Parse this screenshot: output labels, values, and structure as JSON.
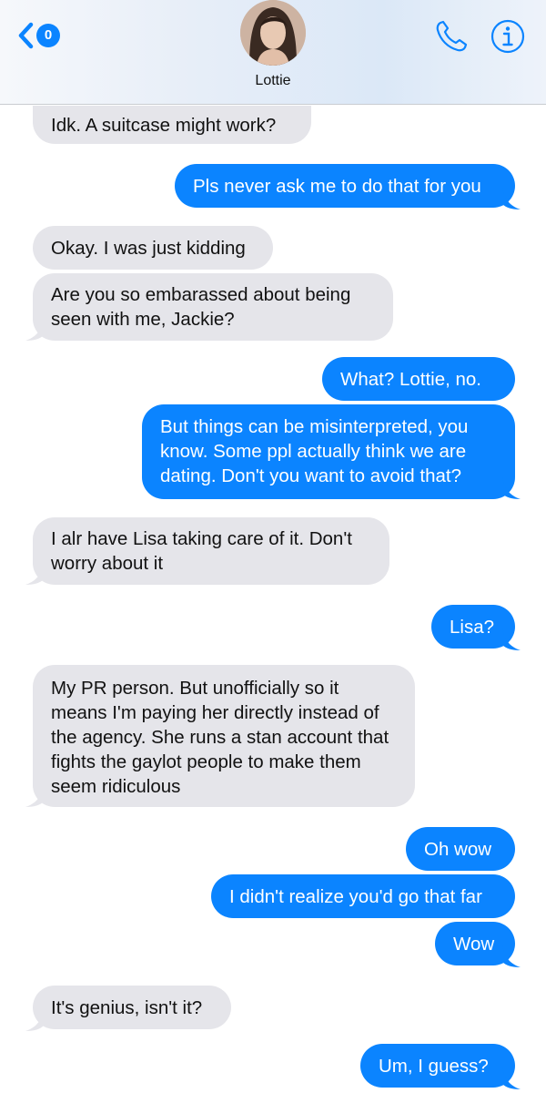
{
  "header": {
    "back_badge": "0",
    "contact_name": "Lottie"
  },
  "colors": {
    "incoming": "#e5e5ea",
    "outgoing": "#0b84ff",
    "accent": "#0b84ff"
  },
  "icons": [
    "chevron-left-icon",
    "phone-icon",
    "info-icon"
  ],
  "messages": [
    {
      "from": "them",
      "text": "Idk. A suitcase might work?"
    },
    {
      "from": "me",
      "text": "Pls never ask me to do that for you"
    },
    {
      "from": "them",
      "text": "Okay. I was just kidding"
    },
    {
      "from": "them",
      "text": "Are you so embarassed about being seen with me, Jackie?"
    },
    {
      "from": "me",
      "text": "What? Lottie, no."
    },
    {
      "from": "me",
      "text": "But things can be misinterpreted, you know. Some ppl actually think we are dating. Don't you want to avoid that?"
    },
    {
      "from": "them",
      "text": "I alr have Lisa taking care of it. Don't worry about it"
    },
    {
      "from": "me",
      "text": "Lisa?"
    },
    {
      "from": "them",
      "text": "My PR person. But unofficially so it means I'm paying her directly instead of the agency. She runs a stan account that fights the gaylot people to make them seem ridiculous"
    },
    {
      "from": "me",
      "text": "Oh wow"
    },
    {
      "from": "me",
      "text": "I didn't realize you'd go that far"
    },
    {
      "from": "me",
      "text": "Wow"
    },
    {
      "from": "them",
      "text": "It's genius, isn't it?"
    },
    {
      "from": "me",
      "text": "Um, I guess?"
    }
  ]
}
